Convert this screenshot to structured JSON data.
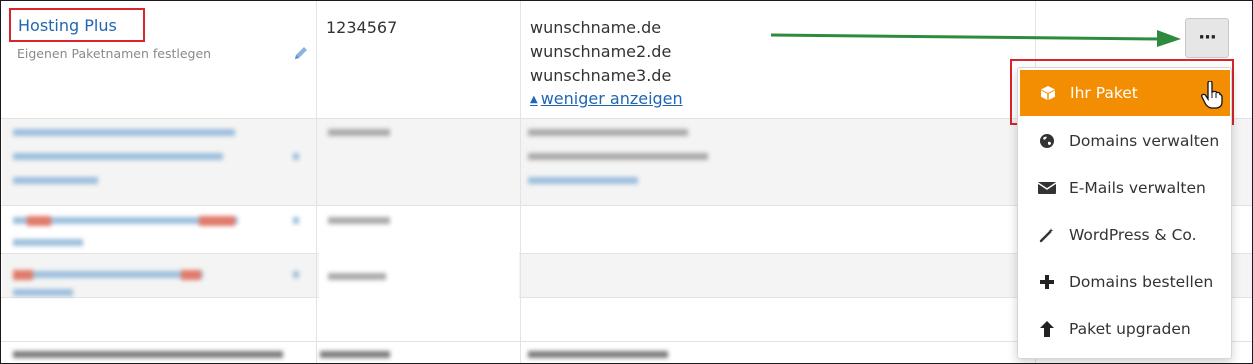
{
  "row": {
    "package_name": "Hosting Plus",
    "package_subtitle": "Eigenen Paketnamen festlegen",
    "package_number": "1234567",
    "domains": [
      "wunschname.de",
      "wunschname2.de",
      "wunschname3.de"
    ],
    "show_less_label": "weniger anzeigen"
  },
  "actions_button": {
    "label": "···"
  },
  "menu": {
    "items": [
      {
        "label": "Ihr Paket",
        "icon": "cube-icon",
        "active": true
      },
      {
        "label": "Domains verwalten",
        "icon": "globe-icon"
      },
      {
        "label": "E-Mails verwalten",
        "icon": "envelope-icon"
      },
      {
        "label": "WordPress & Co.",
        "icon": "magic-wand-icon"
      },
      {
        "label": "Domains bestellen",
        "icon": "plus-icon"
      },
      {
        "label": "Paket upgraden",
        "icon": "arrow-up-icon"
      }
    ]
  },
  "colors": {
    "link": "#1f66b3",
    "active_menu": "#f38d02",
    "highlight_box": "#d9232d",
    "annotation_arrow": "#2e8b3d"
  }
}
